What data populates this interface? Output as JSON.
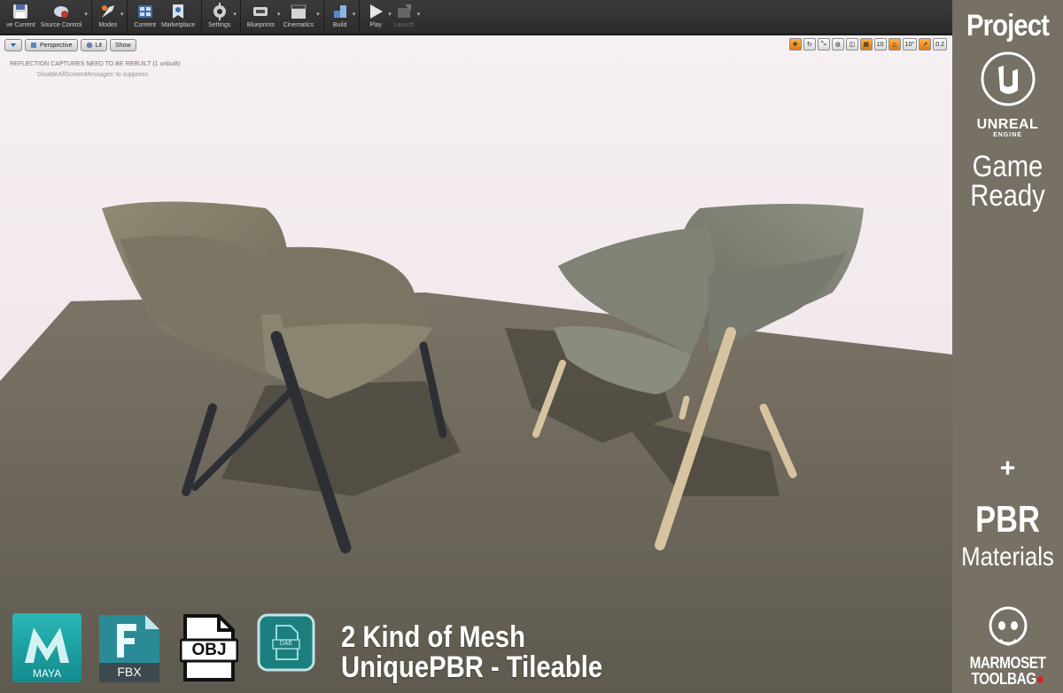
{
  "toolbar": {
    "buttons": [
      {
        "label": "ve Current",
        "icon": "save-icon"
      },
      {
        "label": "Source Control",
        "icon": "source-control-icon"
      },
      {
        "label": "Modes",
        "icon": "modes-icon"
      },
      {
        "label": "Content",
        "icon": "content-browser-icon"
      },
      {
        "label": "Marketplace",
        "icon": "marketplace-icon"
      },
      {
        "label": "Settings",
        "icon": "settings-gear-icon"
      },
      {
        "label": "Blueprints",
        "icon": "blueprints-icon"
      },
      {
        "label": "Cinematics",
        "icon": "cinematics-clapper-icon"
      },
      {
        "label": "Build",
        "icon": "build-icon"
      },
      {
        "label": "Play",
        "icon": "play-icon"
      },
      {
        "label": "Launch",
        "icon": "launch-icon"
      }
    ]
  },
  "viewport": {
    "perspective_label": "Perspective",
    "lit_label": "Lit",
    "show_label": "Show",
    "warning": "REFLECTION CAPTURES NEED TO BE REBUILT (1 unbuilt)",
    "warning_hint": "'DisableAllScreenMessages' to suppress",
    "snap": {
      "grid_value": "10",
      "rotation_value": "10°",
      "scale_value": "0.2"
    }
  },
  "brand": {
    "project": "Project",
    "engine_name": "UNREAL",
    "engine_sub": "ENGINE",
    "game_ready_1": "Game",
    "game_ready_2": "Ready",
    "plus": "+",
    "pbr": "PBR",
    "materials": "Materials",
    "marmoset_1": "MARMOSET",
    "marmoset_2": "TOOLBAG"
  },
  "formats": {
    "maya": "MAYA",
    "fbx": "FBX",
    "obj": "OBJ",
    "dae": "DAE"
  },
  "headline": {
    "line1": "2 Kind of Mesh",
    "line2": "UniquePBR - Tileable"
  },
  "colors": {
    "panel": "#767065",
    "floor": "#6f6a5d",
    "sky": "#f1e9ee",
    "maya_teal": "#1fa9aa",
    "ue_orange": "#e07b10"
  }
}
